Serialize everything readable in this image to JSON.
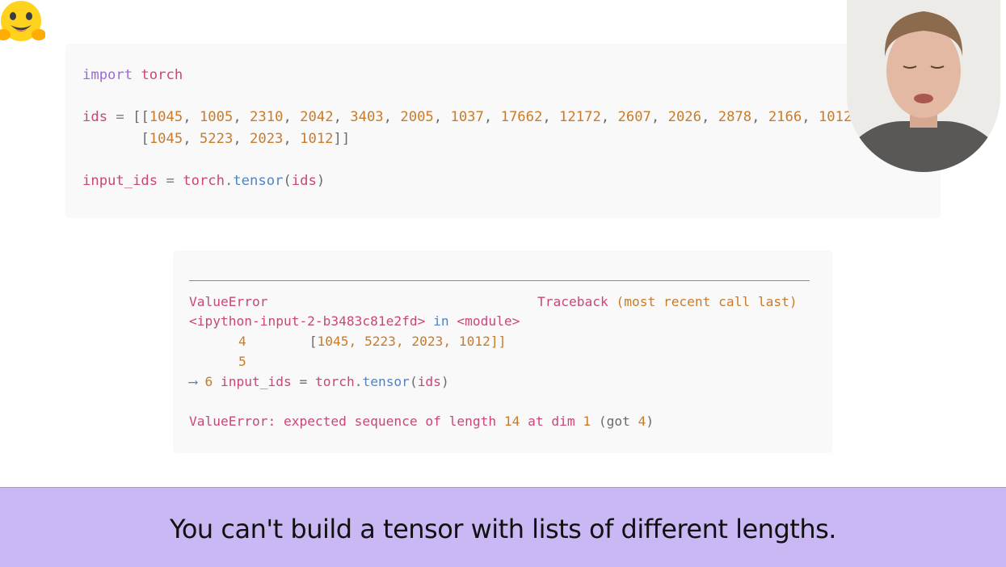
{
  "code": {
    "import_kw": "import",
    "import_mod": "torch",
    "ids_name": "ids",
    "assign_op": "=",
    "row1_open": "[[",
    "row1_values": [
      "1045",
      "1005",
      "2310",
      "2042",
      "3403",
      "2005",
      "1037",
      "17662",
      "12172",
      "2607",
      "2026",
      "2878",
      "2166",
      "1012"
    ],
    "row2_open": "[",
    "row2_values": [
      "1045",
      "5223",
      "2023",
      "1012"
    ],
    "row2_close": "]]",
    "input_ids_name": "input_ids",
    "torch_name": "torch",
    "tensor_fn": "tensor",
    "call_arg": "ids"
  },
  "error": {
    "error_type": "ValueError",
    "traceback_label": "Traceback",
    "traceback_hint": "(most recent call last)",
    "frame_location": "<ipython-input-2-b3483c81e2fd>",
    "frame_in": "in",
    "frame_module": "<module>",
    "line4_no": "4",
    "line4_code_open": "[",
    "line4_code_values": "1045, 5223, 2023, 1012",
    "line4_code_close": "]]",
    "line5_no": "5",
    "arrow": "⟶",
    "line6_no": "6",
    "line6_var": "input_ids",
    "line6_eq": "=",
    "line6_torch": "torch",
    "line6_fn": "tensor",
    "line6_arg": "ids",
    "message_type": "ValueError:",
    "message_text": "expected sequence of length",
    "message_num1": "14",
    "message_text2": "at dim",
    "message_num2": "1",
    "message_paren_open": "(got",
    "message_num3": "4",
    "message_paren_close": ")"
  },
  "subtitle": {
    "text": "You can't build a tensor with lists of different lengths."
  },
  "icons": {
    "logo": "hugging-face-emoji-logo",
    "presenter": "presenter-webcam"
  },
  "colors": {
    "subtitle_bg": "#c9b8f4",
    "keyword": "#9f68d8",
    "identifier": "#c9467a",
    "number": "#c87b2a",
    "function": "#4f84c4"
  }
}
